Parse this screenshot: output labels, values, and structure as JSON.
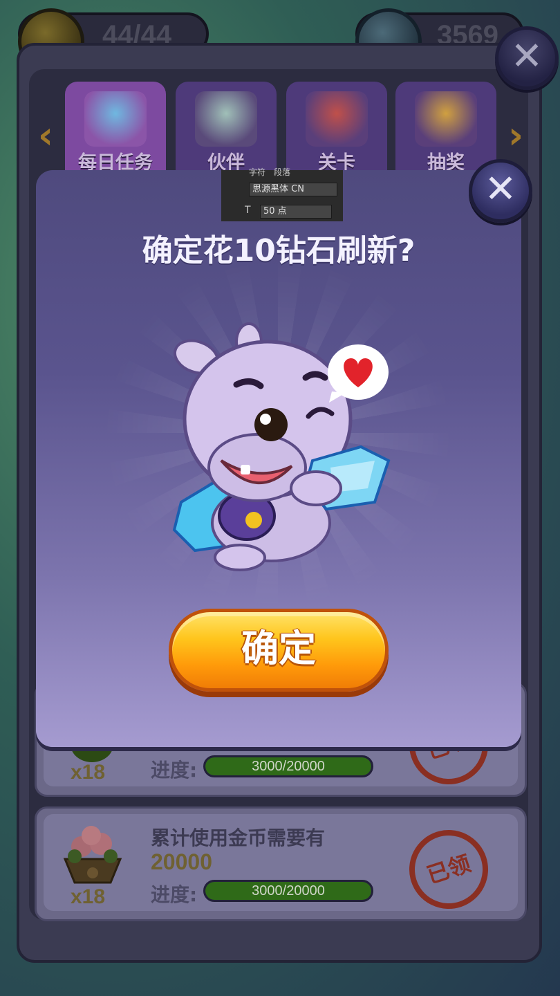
{
  "top_bar": {
    "energy_value": "44/44",
    "diamond_value": "3569"
  },
  "tabs": [
    {
      "label": "每日任务",
      "icon": "gift-box-icon"
    },
    {
      "label": "伙伴",
      "icon": "candy-gift-icon"
    },
    {
      "label": "关卡",
      "icon": "rocket-icon"
    },
    {
      "label": "抽奖",
      "icon": "money-bag-icon"
    }
  ],
  "tasks": [
    {
      "reward_count": "x18",
      "progress_label": "进度:",
      "progress_text": "3000/20000",
      "progress_fraction": 0.15,
      "status": "已领"
    },
    {
      "reward_count": "x18",
      "title": "累计使用金币需要有",
      "target": "20000",
      "progress_label": "进度:",
      "progress_text": "3000/20000",
      "progress_fraction": 0.15,
      "status": "已领"
    }
  ],
  "editor_overlay": {
    "tab_char": "字符",
    "tab_para": "段落",
    "font_name": "思源黑体 CN",
    "font_size": "50 点"
  },
  "modal": {
    "title": "确定花10钻石刷新?",
    "confirm_label": "确定"
  },
  "colors": {
    "confirm_top": "#ffe36a",
    "confirm_bottom": "#f07d06",
    "modal_top": "#4f4a7e",
    "modal_bottom": "#a59bd0",
    "progress_fill": "#2f6a18",
    "stamp": "#8a2f22"
  }
}
